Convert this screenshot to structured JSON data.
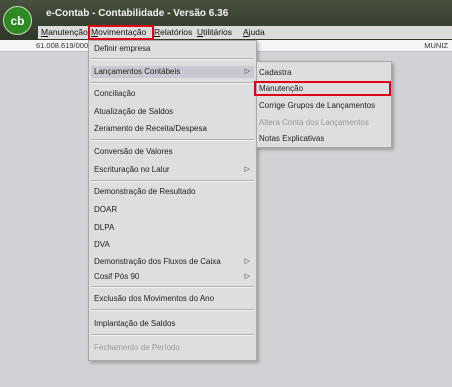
{
  "app": {
    "logo_text": "cb",
    "title": "e-Contab - Contabilidade - Versão 6.36"
  },
  "menubar": {
    "items": [
      {
        "label": "Manutenção",
        "underline": "M",
        "rest": "anutenção"
      },
      {
        "label": "Movimentação",
        "underline": "M",
        "rest": "ovimentação",
        "active": true
      },
      {
        "label": "Relatórios",
        "underline": "R",
        "rest": "elatórios"
      },
      {
        "label": "Utilitários",
        "underline": "U",
        "rest": "tilitários"
      },
      {
        "label": "Ajuda",
        "underline": "A",
        "rest": "juda"
      }
    ]
  },
  "status": {
    "cnpj": "61.008.619/0001-5",
    "user": "MUNIZ"
  },
  "dropdown": {
    "items": {
      "definir_empresa": "Definir empresa",
      "lancamentos_contabeis": "Lançamentos Contábeis",
      "conciliacao": "Conciliação",
      "atualizacao_saldos": "Atualização de Saldos",
      "zeramento": "Zeramento de Receita/Despesa",
      "conversao_valores": "Conversão de Valores",
      "escrituracao_lalur": "Escrituração no Lalur",
      "demonstracao_resultado": "Demonstração de Resultado",
      "doar": "DOAR",
      "dlpa": "DLPA",
      "dva": "DVA",
      "demonstracao_fluxos": "Demonstração dos Fluxos de Caixa",
      "cosif": "Cosif Pós 90",
      "exclusao_movimentos": "Exclusão dos Movimentos do Ano",
      "implantacao_saldos": "Implantação de Saldos",
      "fechamento_periodo": "Fechamento de Período"
    },
    "arrow": "▷"
  },
  "submenu": {
    "items": {
      "cadastra": "Cadastra",
      "manutencao": "Manutenção",
      "corrige_grupos": "Corrige Grupos de Lançamentos",
      "altera_conta": "Altera Conta dos Lançamentos",
      "notas_explicativas": "Notas Explicativas"
    }
  },
  "colors": {
    "highlight": "#e0001a",
    "logo_green": "#2d8a22",
    "titlebar": "#3a4433"
  }
}
